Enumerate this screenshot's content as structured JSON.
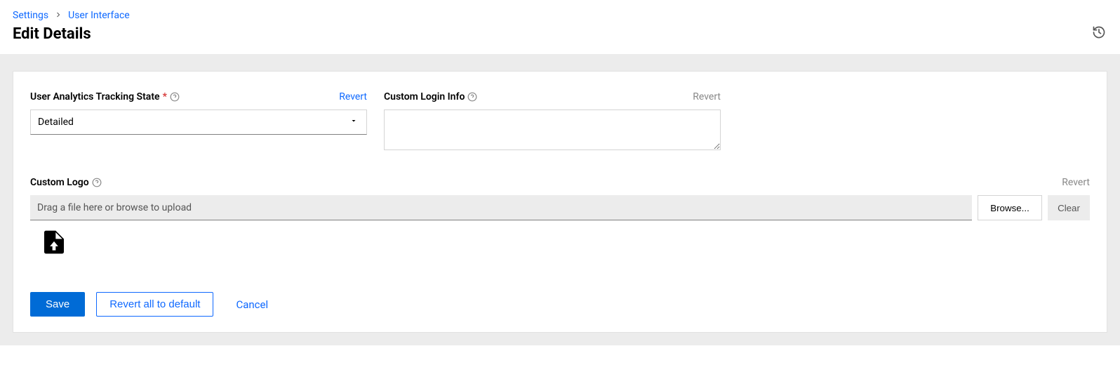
{
  "breadcrumb": {
    "root": "Settings",
    "current": "User Interface"
  },
  "page_title": "Edit Details",
  "fields": {
    "tracking": {
      "label": "User Analytics Tracking State",
      "value": "Detailed",
      "revert": "Revert"
    },
    "loginInfo": {
      "label": "Custom Login Info",
      "value": "",
      "revert": "Revert"
    },
    "logo": {
      "label": "Custom Logo",
      "placeholder": "Drag a file here or browse to upload",
      "browse": "Browse...",
      "clear": "Clear",
      "revert": "Revert"
    }
  },
  "footer": {
    "save": "Save",
    "revert_all": "Revert all to default",
    "cancel": "Cancel"
  }
}
